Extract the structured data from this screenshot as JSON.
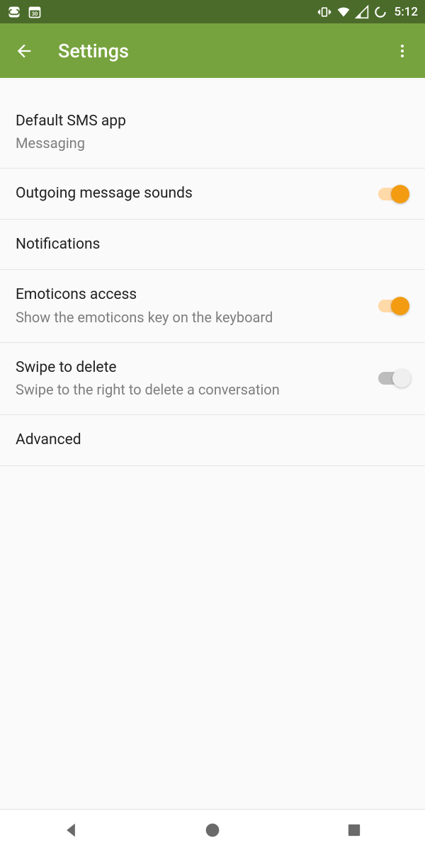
{
  "status": {
    "time": "5:12"
  },
  "appbar": {
    "title": "Settings"
  },
  "settings": {
    "default_sms": {
      "title": "Default SMS app",
      "subtitle": "Messaging"
    },
    "outgoing_sounds": {
      "title": "Outgoing message sounds",
      "on": true
    },
    "notifications": {
      "title": "Notifications"
    },
    "emoticons": {
      "title": "Emoticons access",
      "subtitle": "Show the emoticons key on the keyboard",
      "on": true
    },
    "swipe_delete": {
      "title": "Swipe to delete",
      "subtitle": "Swipe to the right to delete a conversation",
      "on": false
    },
    "advanced": {
      "title": "Advanced"
    }
  },
  "colors": {
    "status_bar": "#4b6b2a",
    "app_bar": "#77a33e",
    "accent": "#f39c12"
  }
}
